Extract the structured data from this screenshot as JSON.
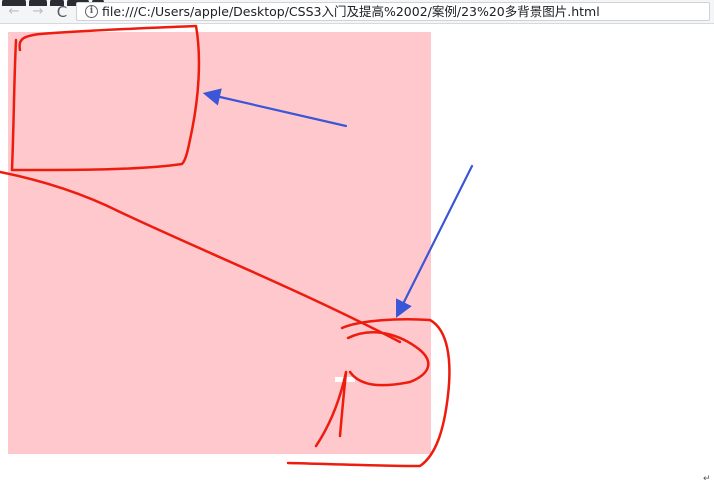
{
  "browser": {
    "address": {
      "url": "file:///C:/Users/apple/Desktop/CSS3入门及提高%2002/案例/23%20多背景图片.html",
      "info_icon": "info-icon"
    },
    "nav": {
      "back_icon": "back-arrow-icon",
      "back_glyph": "←",
      "forward_icon": "forward-arrow-icon",
      "forward_glyph": "→",
      "reload_icon": "reload-icon",
      "reload_glyph": "C"
    }
  },
  "page": {
    "box_color": "#ffc8cd"
  },
  "annotations": {
    "red_ink_color": "#ee1c0e",
    "blue_arrow_color": "#3b56d6"
  }
}
